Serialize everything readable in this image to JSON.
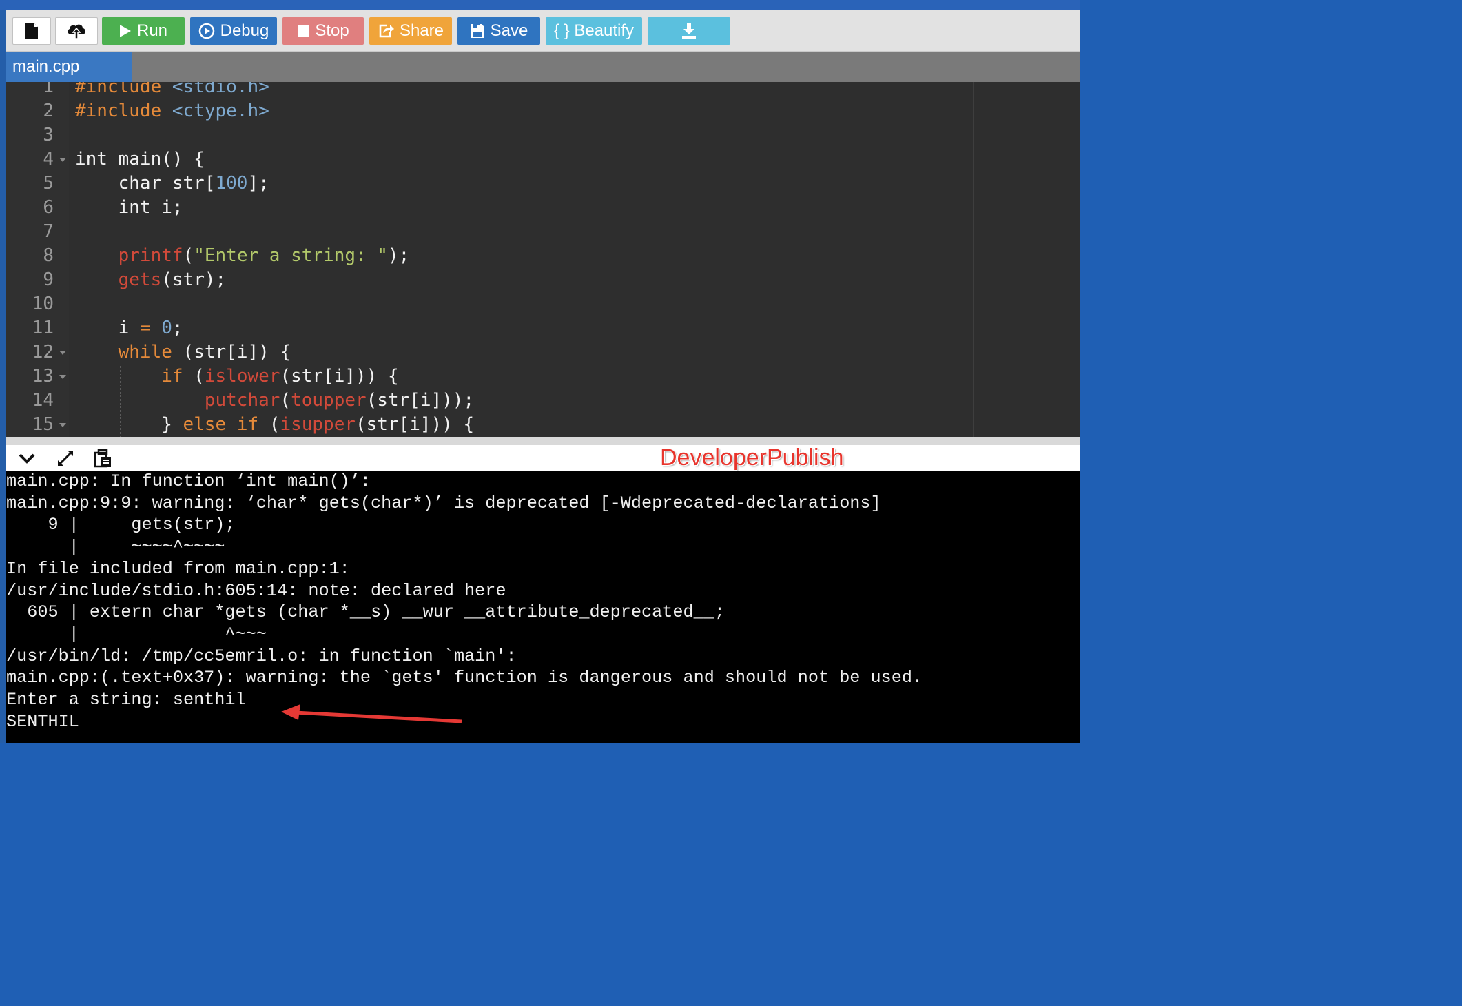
{
  "toolbar": {
    "buttons": [
      {
        "id": "new-file",
        "icon": "file-icon"
      },
      {
        "id": "upload",
        "icon": "cloud-upload-icon"
      },
      {
        "id": "run",
        "label": "Run",
        "icon": "play-icon",
        "color": "#4cb050"
      },
      {
        "id": "debug",
        "label": "Debug",
        "icon": "debug-icon",
        "color": "#2f74c0"
      },
      {
        "id": "stop",
        "label": "Stop",
        "icon": "stop-icon",
        "color": "#e07f7f"
      },
      {
        "id": "share",
        "label": "Share",
        "icon": "share-icon",
        "color": "#f0a43a"
      },
      {
        "id": "save",
        "label": "Save",
        "icon": "floppy-icon",
        "color": "#2f74c0"
      },
      {
        "id": "beautify",
        "label": "{ } Beautify",
        "color": "#5bc0de"
      },
      {
        "id": "download",
        "icon": "download-icon",
        "color": "#5bc0de"
      }
    ]
  },
  "tabs": [
    {
      "label": "main.cpp",
      "active": true
    }
  ],
  "editor": {
    "line_numbers": [
      "1",
      "2",
      "3",
      "4",
      "5",
      "6",
      "7",
      "8",
      "9",
      "10",
      "11",
      "12",
      "13",
      "14",
      "15"
    ],
    "fold_lines": [
      4,
      12,
      13,
      15
    ],
    "lines": [
      [
        {
          "t": "#include ",
          "c": "kw"
        },
        {
          "t": "<stdio.h>",
          "c": "inc"
        }
      ],
      [
        {
          "t": "#include ",
          "c": "kw"
        },
        {
          "t": "<ctype.h>",
          "c": "inc"
        }
      ],
      [],
      [
        {
          "t": "int main() {",
          "c": ""
        }
      ],
      [
        {
          "t": "    char str[",
          "c": ""
        },
        {
          "t": "100",
          "c": "num"
        },
        {
          "t": "];",
          "c": ""
        }
      ],
      [
        {
          "t": "    int i;",
          "c": ""
        }
      ],
      [],
      [
        {
          "t": "    ",
          "c": ""
        },
        {
          "t": "printf",
          "c": "fn"
        },
        {
          "t": "(",
          "c": ""
        },
        {
          "t": "\"Enter a string: \"",
          "c": "str"
        },
        {
          "t": ");",
          "c": ""
        }
      ],
      [
        {
          "t": "    ",
          "c": ""
        },
        {
          "t": "gets",
          "c": "fn"
        },
        {
          "t": "(str);",
          "c": ""
        }
      ],
      [],
      [
        {
          "t": "    i ",
          "c": ""
        },
        {
          "t": "=",
          "c": "kw"
        },
        {
          "t": " ",
          "c": ""
        },
        {
          "t": "0",
          "c": "num"
        },
        {
          "t": ";",
          "c": ""
        }
      ],
      [
        {
          "t": "    ",
          "c": ""
        },
        {
          "t": "while",
          "c": "kw"
        },
        {
          "t": " (str[i]) {",
          "c": ""
        }
      ],
      [
        {
          "t": "        ",
          "c": ""
        },
        {
          "t": "if",
          "c": "kw"
        },
        {
          "t": " (",
          "c": ""
        },
        {
          "t": "islower",
          "c": "fn"
        },
        {
          "t": "(str[i])) {",
          "c": ""
        }
      ],
      [
        {
          "t": "            ",
          "c": ""
        },
        {
          "t": "putchar",
          "c": "fn"
        },
        {
          "t": "(",
          "c": ""
        },
        {
          "t": "toupper",
          "c": "fn"
        },
        {
          "t": "(str[i]));",
          "c": ""
        }
      ],
      [
        {
          "t": "        } ",
          "c": ""
        },
        {
          "t": "else if",
          "c": "kw"
        },
        {
          "t": " (",
          "c": ""
        },
        {
          "t": "isupper",
          "c": "fn"
        },
        {
          "t": "(str[i])) {",
          "c": ""
        }
      ]
    ]
  },
  "output_toolbar": {
    "icons": [
      "chevron-down-icon",
      "expand-icon",
      "copy-icon"
    ],
    "watermark": "DeveloperPublish"
  },
  "console": {
    "lines": [
      "main.cpp: In function ‘int main()’:",
      "main.cpp:9:9: warning: ‘char* gets(char*)’ is deprecated [-Wdeprecated-declarations]",
      "    9 |     gets(str);",
      "      |     ~~~~^~~~~",
      "In file included from main.cpp:1:",
      "/usr/include/stdio.h:605:14: note: declared here",
      "  605 | extern char *gets (char *__s) __wur __attribute_deprecated__;",
      "      |              ^~~~",
      "/usr/bin/ld: /tmp/cc5emril.o: in function `main':",
      "main.cpp:(.text+0x37): warning: the `gets' function is dangerous and should not be used.",
      "Enter a string: senthil",
      "SENTHIL"
    ]
  },
  "colors": {
    "arrow": "#e53935",
    "editor_bg": "#2e2e2e",
    "console_bg": "#000000"
  }
}
